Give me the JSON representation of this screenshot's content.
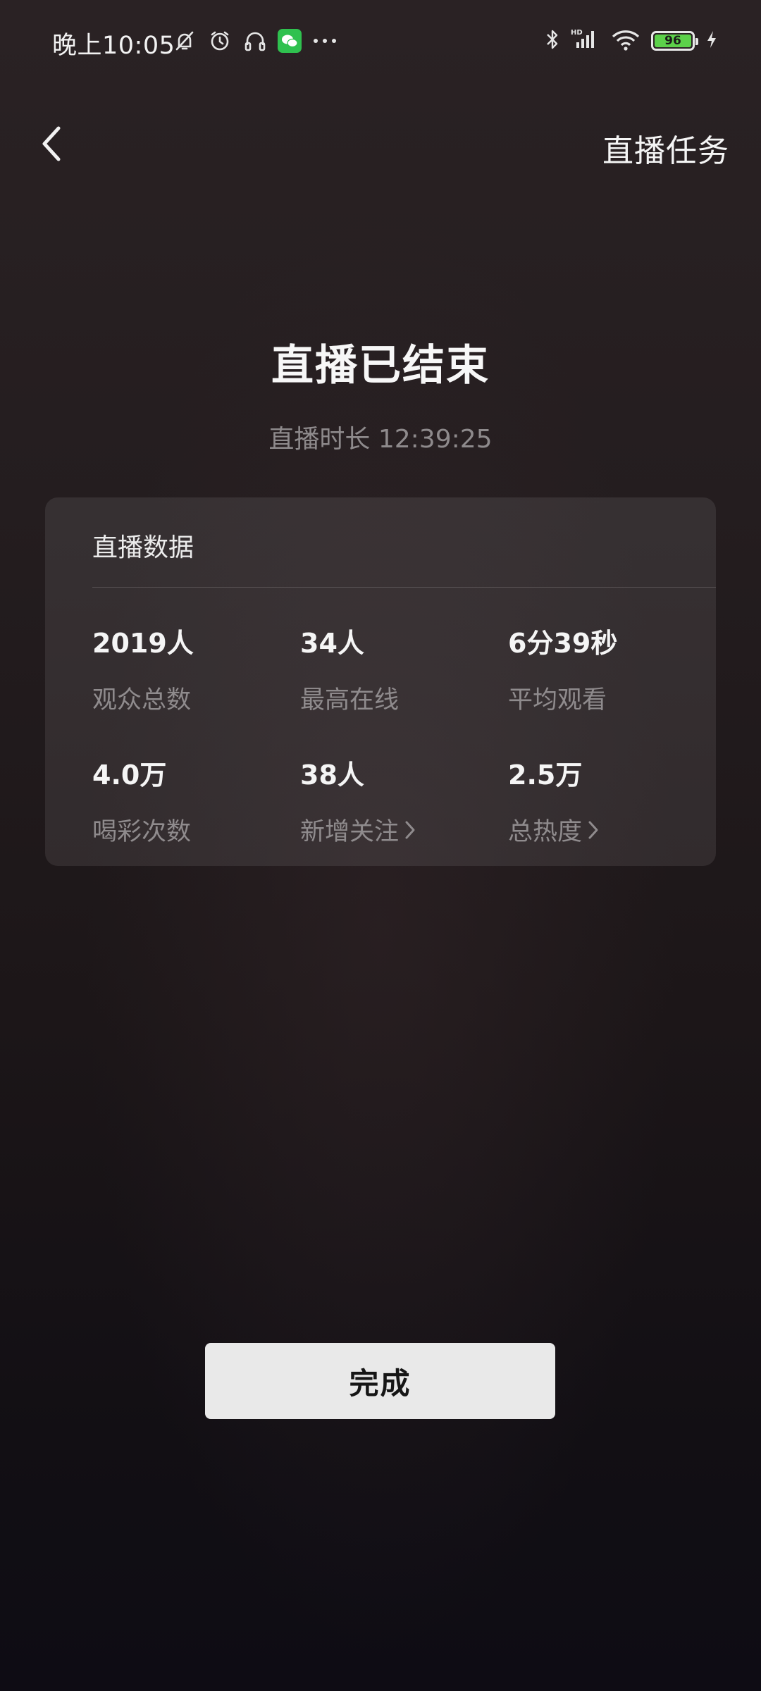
{
  "status_bar": {
    "time": "晚上10:05",
    "left_icons": [
      "mute-bell-icon",
      "alarm-icon",
      "headphones-icon",
      "wechat-icon",
      "more-dots-icon"
    ],
    "right_icons": [
      "bluetooth-icon",
      "hd-signal-icon",
      "wifi-icon",
      "battery-icon",
      "charging-icon"
    ],
    "battery_level": "96",
    "battery_color": "#5cd14a"
  },
  "header": {
    "back_icon": "chevron-left-icon",
    "right_link": "直播任务"
  },
  "main": {
    "title": "直播已结束",
    "duration": "直播时长 12:39:25"
  },
  "card": {
    "title": "直播数据",
    "stats": [
      {
        "value": "2019人",
        "label": "观众总数",
        "has_chevron": false
      },
      {
        "value": "34人",
        "label": "最高在线",
        "has_chevron": false
      },
      {
        "value": "6分39秒",
        "label": "平均观看",
        "has_chevron": false
      },
      {
        "value": "4.0万",
        "label": "喝彩次数",
        "has_chevron": false
      },
      {
        "value": "38人",
        "label": "新增关注",
        "has_chevron": true
      },
      {
        "value": "2.5万",
        "label": "总热度",
        "has_chevron": true
      }
    ]
  },
  "footer": {
    "done_label": "完成"
  }
}
